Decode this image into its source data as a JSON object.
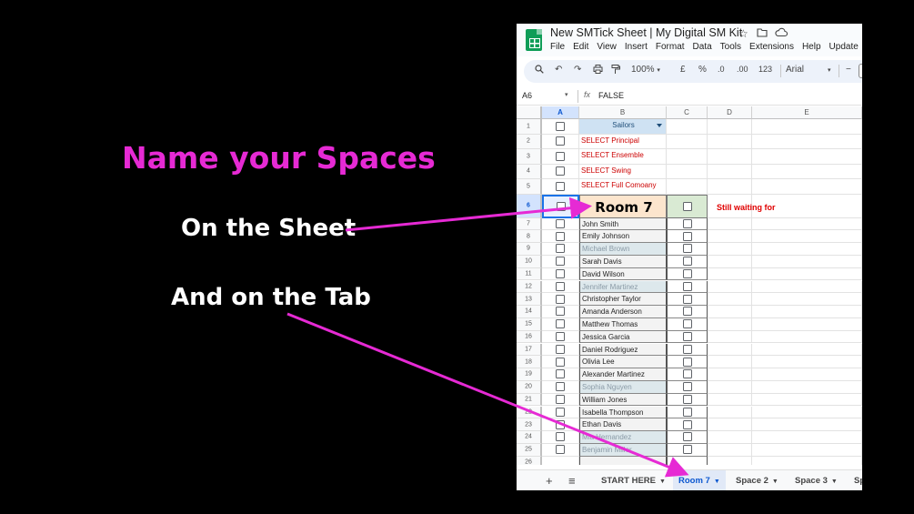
{
  "slide": {
    "title": "Name your Spaces",
    "callout_sheet": "On the Sheet",
    "callout_tab": "And on the Tab",
    "accent_color": "#e62ad4"
  },
  "sheets": {
    "doc_title": "New SMTick Sheet | My Digital SM Kit",
    "title_icons": [
      "star-icon",
      "move-folder-icon",
      "cloud-status-icon"
    ],
    "menu": [
      "File",
      "Edit",
      "View",
      "Insert",
      "Format",
      "Data",
      "Tools",
      "Extensions",
      "Help",
      "Update"
    ],
    "toolbar": {
      "zoom": "100%",
      "currency": "£",
      "percent": "%",
      "dec_decrease": ".0",
      "dec_increase": ".00",
      "number_format": "123",
      "font": "Arial",
      "icons": [
        "search-icon",
        "undo-icon",
        "redo-icon",
        "print-icon",
        "paint-format-icon"
      ]
    },
    "formula_bar": {
      "cell_ref": "A6",
      "fx": "fx",
      "value": "FALSE"
    },
    "columns": [
      "A",
      "B",
      "C",
      "D",
      "E"
    ],
    "rows": [
      {
        "num": "1",
        "b": "Sailors"
      },
      {
        "num": "2",
        "b": "SELECT Principal"
      },
      {
        "num": "3",
        "b": "SELECT Ensemble"
      },
      {
        "num": "4",
        "b": "SELECT Swing"
      },
      {
        "num": "5",
        "b": "SELECT Full Comoany"
      },
      {
        "num": "6",
        "b": "Room 7",
        "e": "Still waiting for"
      },
      {
        "num": "7",
        "b": "John Smith"
      },
      {
        "num": "8",
        "b": "Emily Johnson"
      },
      {
        "num": "9",
        "b": "Michael Brown"
      },
      {
        "num": "10",
        "b": "Sarah Davis"
      },
      {
        "num": "11",
        "b": "David Wilson"
      },
      {
        "num": "12",
        "b": "Jennifer Martinez"
      },
      {
        "num": "13",
        "b": "Christopher Taylor"
      },
      {
        "num": "14",
        "b": "Amanda Anderson"
      },
      {
        "num": "15",
        "b": "Matthew Thomas"
      },
      {
        "num": "16",
        "b": "Jessica Garcia"
      },
      {
        "num": "17",
        "b": "Daniel Rodriguez"
      },
      {
        "num": "18",
        "b": "Olivia Lee"
      },
      {
        "num": "19",
        "b": "Alexander Martinez"
      },
      {
        "num": "20",
        "b": "Sophia Nguyen"
      },
      {
        "num": "21",
        "b": "William Jones"
      },
      {
        "num": "22",
        "b": "Isabella Thompson"
      },
      {
        "num": "23",
        "b": "Ethan Davis"
      },
      {
        "num": "24",
        "b": "Mia Hernandez"
      },
      {
        "num": "25",
        "b": "Benjamin Miller"
      },
      {
        "num": "26",
        "b": ""
      }
    ],
    "tabs": {
      "add": "+",
      "all_sheets": "≡",
      "items": [
        "START HERE",
        "Room 7",
        "Space 2",
        "Space 3",
        "Sp"
      ],
      "active": "Room 7"
    }
  }
}
